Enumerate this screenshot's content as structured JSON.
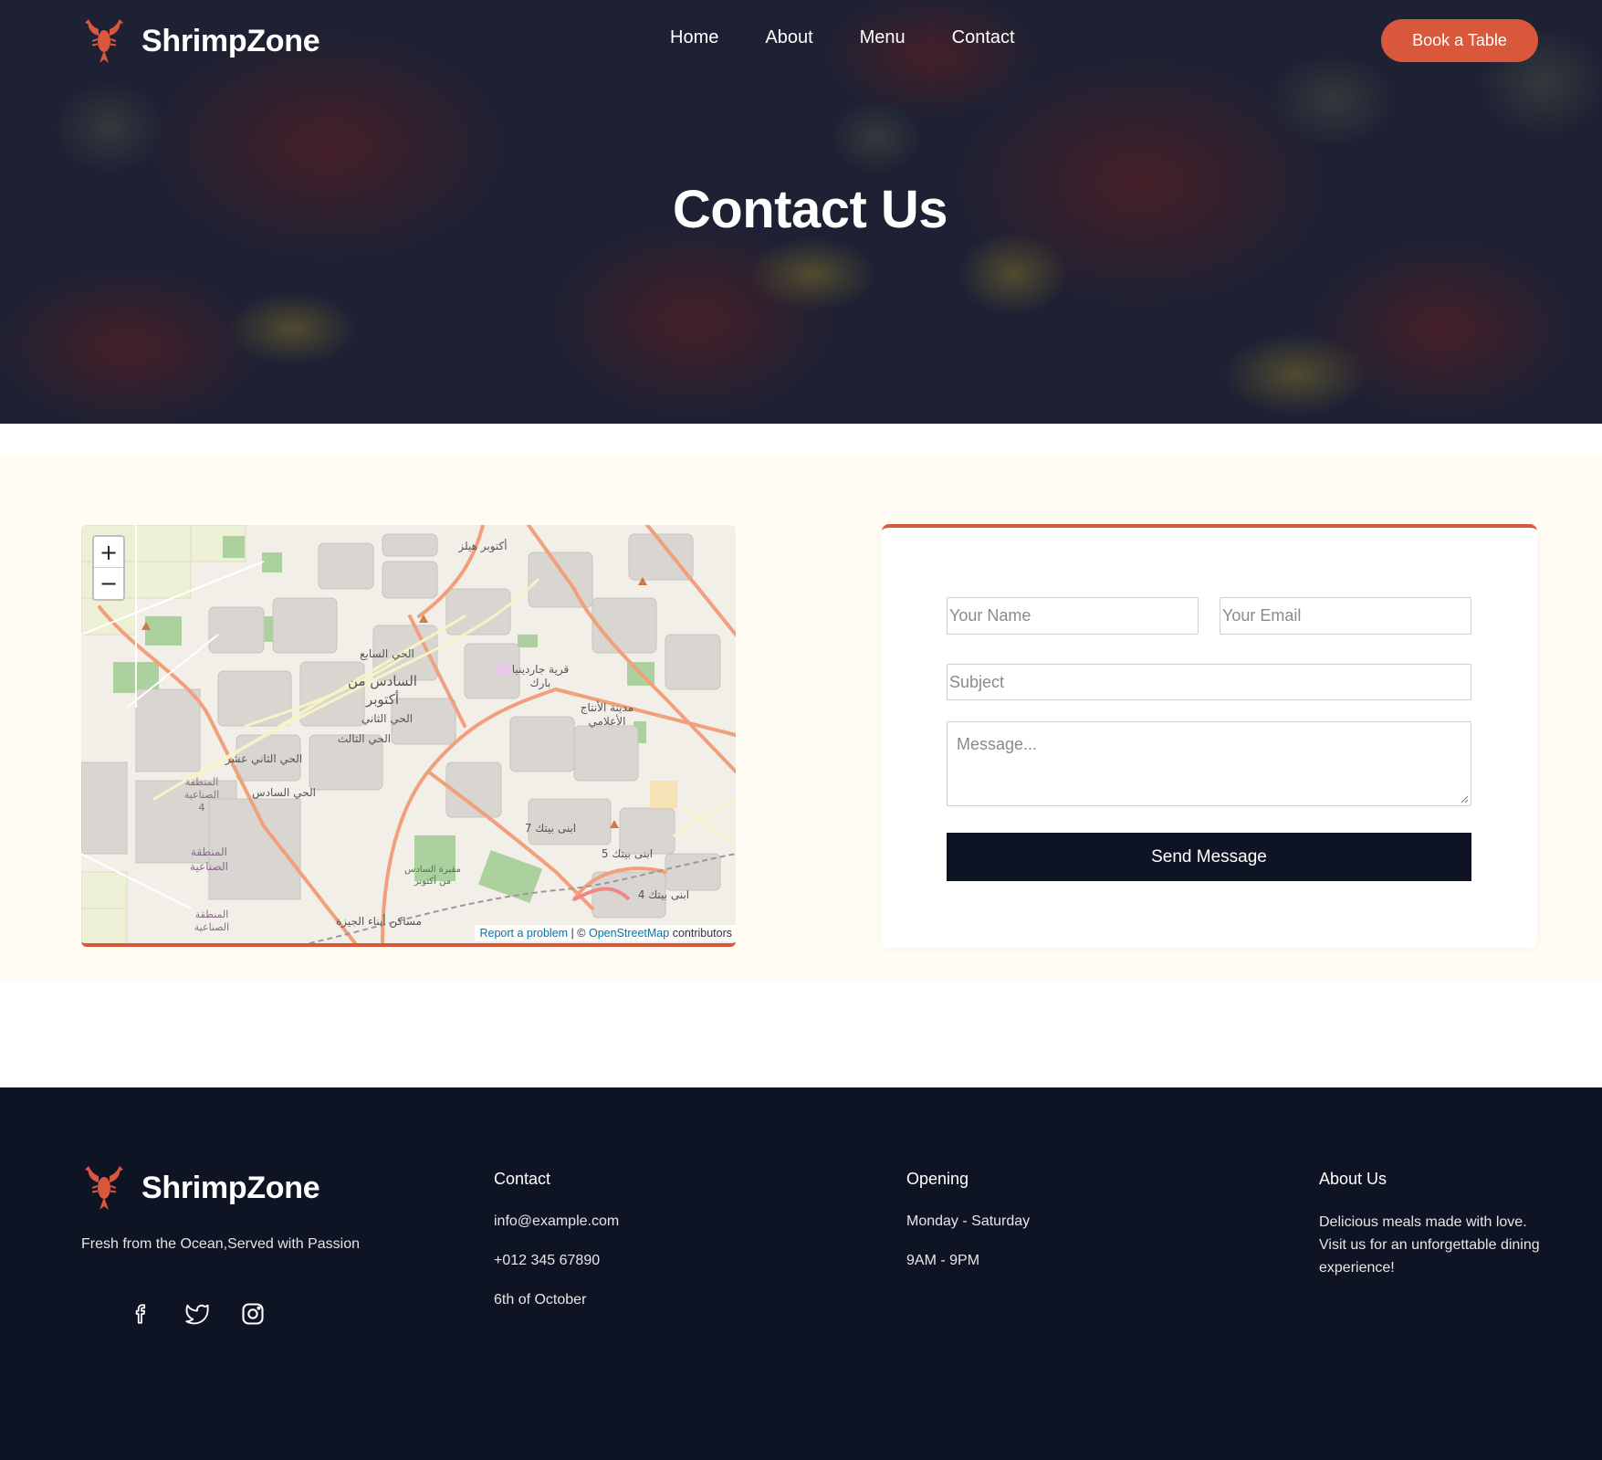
{
  "header": {
    "brand": "ShrimpZone",
    "nav": [
      "Home",
      "About",
      "Menu",
      "Contact"
    ],
    "cta": "Book a Table"
  },
  "hero": {
    "title": "Contact Us"
  },
  "map": {
    "zoom_in": "+",
    "zoom_out": "−",
    "attribution": {
      "report": "Report a problem",
      "separator": " | © ",
      "osm": "OpenStreetMap",
      "suffix": " contributors"
    },
    "labels": [
      "أكتوبر هيلز",
      "الحي السابع",
      "السادس من",
      "أكتوبر",
      "الحي الثاني",
      "الحي الثالث",
      "الحي الثاني عشر",
      "الحي السادس",
      "قرية جاردينيا",
      "بارك",
      "مدينة الأنتاج",
      "الأعلامي",
      "المنطقة",
      "الصناعية",
      "4",
      "المنطقة",
      "الصناعية",
      "المنطقة",
      "الصناعية",
      "ابنى بيتك 7",
      "ابنى بيتك 5",
      "ابنى بيتك 4",
      "مقبرة السادس",
      "من أكتوبر",
      "مساكن أبناء الجيزة"
    ]
  },
  "form": {
    "name_placeholder": "Your Name",
    "email_placeholder": "Your Email",
    "subject_placeholder": "Subject",
    "message_placeholder": "Message...",
    "submit": "Send Message"
  },
  "footer": {
    "brand": "ShrimpZone",
    "tagline": "Fresh from the Ocean,Served with Passion",
    "socials": [
      "facebook-icon",
      "twitter-icon",
      "instagram-icon"
    ],
    "contact": {
      "heading": "Contact",
      "email": "info@example.com",
      "phone": "+012 345 67890",
      "address": "6th of October"
    },
    "opening": {
      "heading": "Opening",
      "days": "Monday - Saturday",
      "hours": "9AM - 9PM"
    },
    "about": {
      "heading": "About Us",
      "text": "Delicious meals made with love. Visit us for an unforgettable dining experience!"
    }
  },
  "colors": {
    "accent": "#d9573b",
    "dark": "#0f1424",
    "section_bg": "#fffcf4"
  }
}
